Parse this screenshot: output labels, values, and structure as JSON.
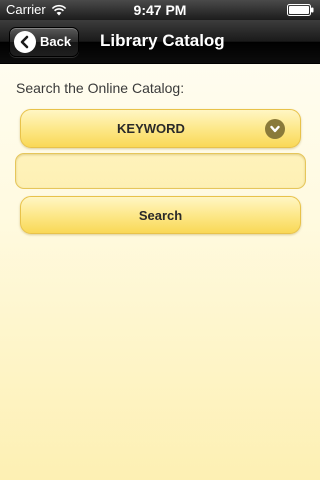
{
  "status_bar": {
    "carrier": "Carrier",
    "time": "9:47 PM",
    "icons": [
      "wifi-icon",
      "battery-icon"
    ]
  },
  "nav": {
    "back_label": "Back",
    "title": "Library Catalog",
    "back_icon": "back-arrow-icon"
  },
  "search": {
    "heading": "Search the Online Catalog:",
    "type_selected": "KEYWORD",
    "type_icon": "chevron-down-icon",
    "input_value": "",
    "input_placeholder": "",
    "button_label": "Search"
  },
  "colors": {
    "accent": "#fde88a",
    "accent_border": "#e8c24a",
    "background": "#fffae0",
    "nav_bar": "#1a1a1a"
  }
}
